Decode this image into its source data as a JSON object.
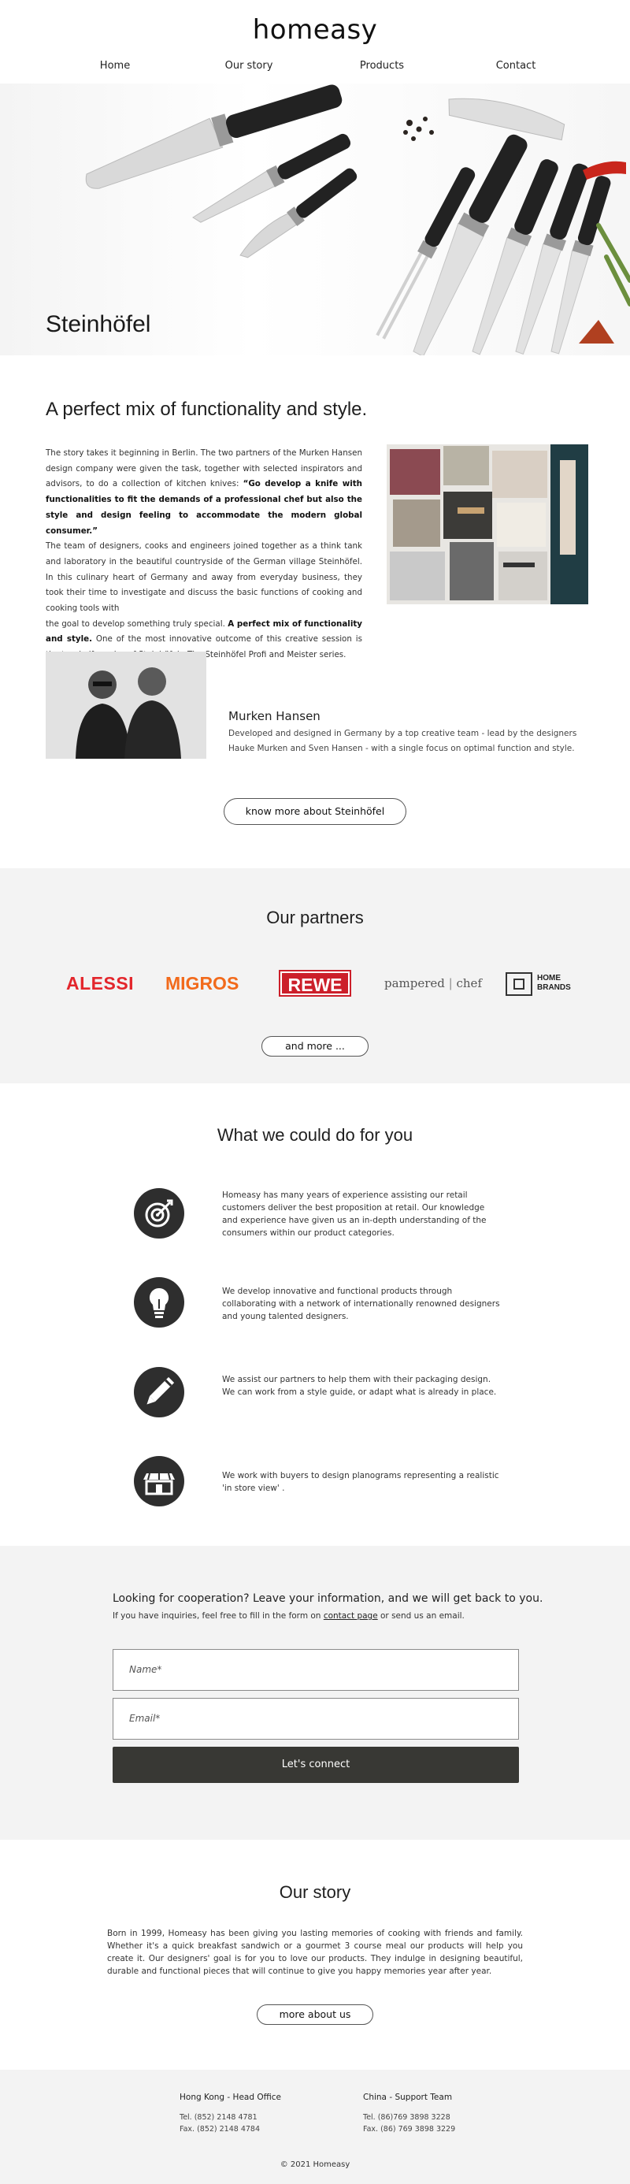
{
  "header": {
    "logo": "homeasy",
    "nav": [
      {
        "label": "Home"
      },
      {
        "label": "Our story"
      },
      {
        "label": "Products"
      },
      {
        "label": "Contact"
      }
    ]
  },
  "hero": {
    "title": "Steinhöfel"
  },
  "intro": {
    "heading": "A perfect mix of functionality and style.",
    "p1_a": "The story takes it beginning in Berlin. The two partners of the Murken Hansen design company were given the task, together with selected inspirators and advisors, to do a collection of kitchen knives: ",
    "p1_b": "“Go develop a knife with functionalities to fit the demands of a professional chef but also the style and design feeling to accommodate the modern global consumer.”",
    "p2": "The team of designers, cooks and engineers joined together as a think tank and laboratory in the beautiful countryside of the German village Steinhöfel. In this culinary heart of Germany and away from everyday business, they took their time to investigate and discuss the basic functions of cooking and cooking tools with",
    "p3_a": "the goal to develop something truly special. ",
    "p3_b": "A perfect mix of functionality and style.",
    "p3_c": " One of the most innovative outcome of this creative session is the two knife series of Steinhöfel - The Steinhöfel Profi and Meister series."
  },
  "designers": {
    "name": "Murken Hansen",
    "description": "Developed and designed in Germany by a top creative team - lead by the designers Hauke Murken and Sven Hansen - with a single focus on optimal function and style.",
    "button": "know more about Steinhöfel"
  },
  "partners": {
    "title": "Our partners",
    "logos": [
      "ALESSI",
      "MIGROS",
      "REWE",
      "pampered",
      "chef",
      "HOME",
      "BRANDS"
    ],
    "button": "and more ..."
  },
  "services": {
    "title": "What we could do for you",
    "items": [
      {
        "icon": "target-icon",
        "text": "Homeasy has many years of experience assisting our retail customers deliver the best proposition at retail. Our knowledge and experience have given us an in-depth understanding of the consumers within our product categories."
      },
      {
        "icon": "lightbulb-icon",
        "text": "We develop innovative and functional products through collaborating with a network of internationally renowned designers and young talented designers."
      },
      {
        "icon": "pencil-icon",
        "text": "We assist our partners to help them with their packaging design. We can work from a style guide, or adapt what is already in place."
      },
      {
        "icon": "storefront-icon",
        "text": "We work with buyers to design planograms representing a realistic 'in store view' ."
      }
    ]
  },
  "contact": {
    "heading": "Looking for cooperation? Leave your information, and we will get back to you.",
    "sub_a": "If you have inquiries, feel free to fill in the form on ",
    "sub_link": "contact page",
    "sub_b": " or send us an email.",
    "name_placeholder": "Name*",
    "email_placeholder": "Email*",
    "button": "Let's connect"
  },
  "our_story": {
    "title": "Our story",
    "text": "Born in 1999, Homeasy has been giving you lasting memories of cooking with friends and family. Whether it's a quick breakfast sandwich or a gourmet 3 course meal our products will help you create it. Our designers' goal is for you to love our products. They indulge in designing beautiful, durable and functional pieces that will continue to give you happy memories year after year.",
    "button": "more about us"
  },
  "footer": {
    "offices": [
      {
        "title": "Hong Kong - Head Office",
        "tel": "Tel. (852) 2148 4781",
        "fax": "Fax. (852) 2148 4784"
      },
      {
        "title": "China - Support Team",
        "tel": "Tel. (86)769 3898 3228",
        "fax": "Fax. (86) 769 3898 3229"
      }
    ],
    "copyright": "© 2021 Homeasy"
  },
  "colors": {
    "dark_button": "#383834",
    "grey_section": "#f3f3f3",
    "alessi": "#e3262c",
    "migros": "#f26a1b",
    "rewe": "#cc1f2a"
  }
}
